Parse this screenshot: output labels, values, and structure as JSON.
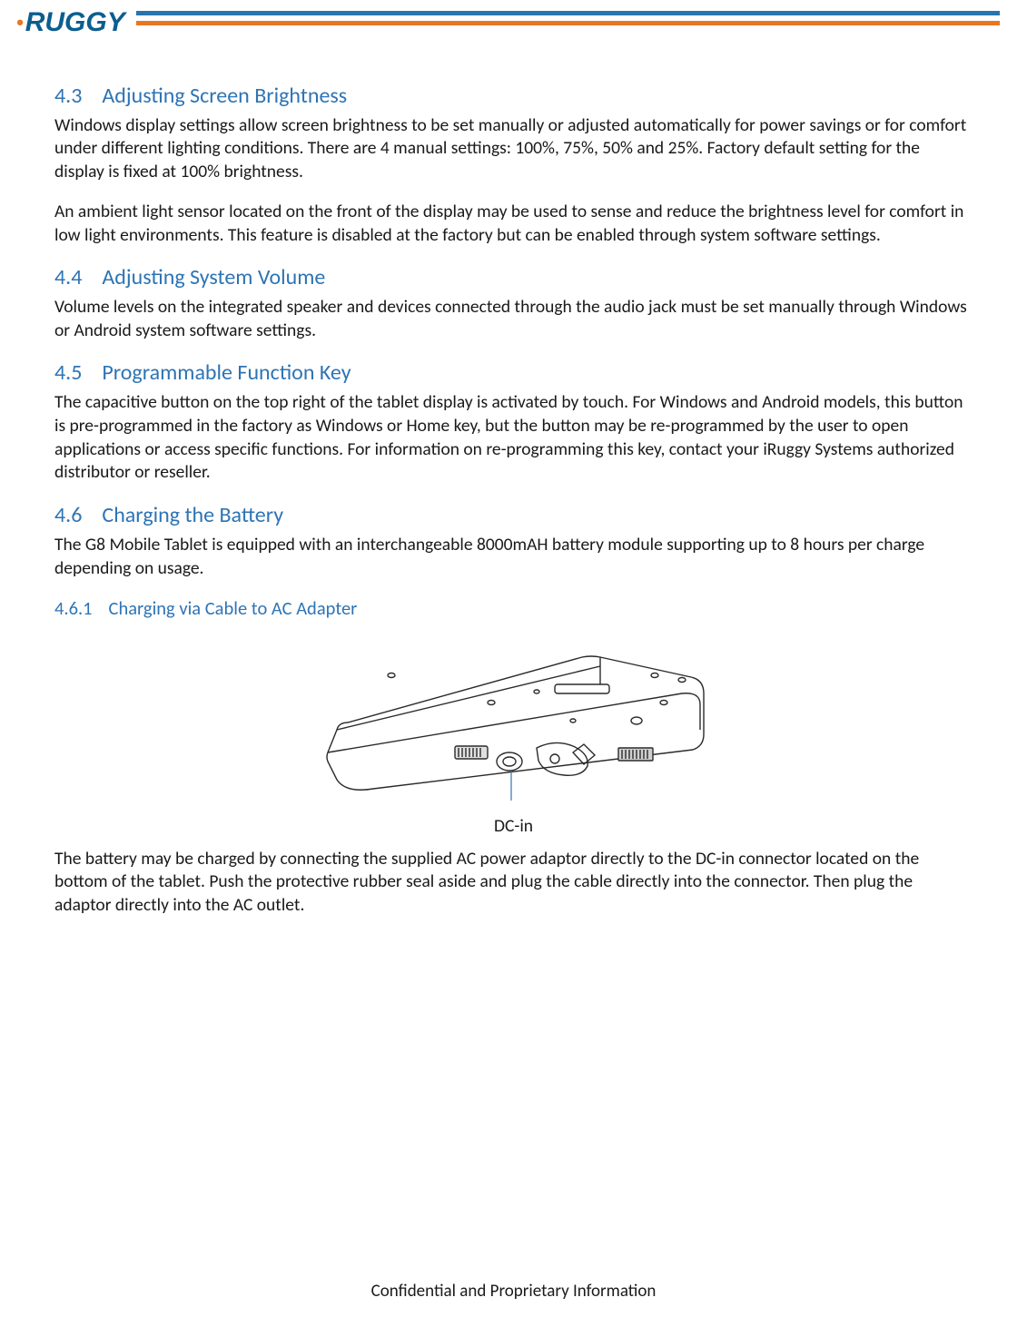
{
  "logo": {
    "dot_char": "•",
    "text": "RUGGY"
  },
  "sections": [
    {
      "num": "4.3",
      "title": "Adjusting Screen Brightness",
      "paras": [
        "Windows display settings allow screen brightness to be set manually or adjusted automatically for power savings or for comfort under different lighting conditions.  There are 4 manual settings: 100%, 75%, 50% and 25%.  Factory default setting for the display is fixed at 100% brightness.",
        "An ambient light sensor located on the front of the display may be used to sense and reduce the brightness level for comfort in low light environments.  This feature is disabled at the factory but can be enabled through system software settings."
      ]
    },
    {
      "num": "4.4",
      "title": "Adjusting System Volume",
      "paras": [
        "Volume levels on the integrated speaker and devices connected through the audio jack must be set manually through Windows or Android system software settings."
      ]
    },
    {
      "num": "4.5",
      "title": "Programmable Function Key",
      "paras": [
        "The capacitive button on the top right of the tablet display is activated by touch. For Windows and Android models, this button is pre-programmed in the factory as Windows or Home key, but the button may be re-programmed by the user to open applications or access specific functions.  For information on re-programming this key, contact your iRuggy Systems authorized distributor or reseller."
      ]
    },
    {
      "num": "4.6",
      "title": "Charging the Battery",
      "paras": [
        "The G8 Mobile Tablet is equipped with an interchangeable 8000mAH battery module supporting up to 8 hours per charge depending on usage."
      ],
      "subsections": [
        {
          "num": "4.6.1",
          "title": "Charging via Cable to AC Adapter",
          "figure_label": "DC-in",
          "paras_after": [
            "The battery may be charged by connecting the supplied AC power adaptor directly to the DC-in connector located on the bottom of the tablet.  Push the protective rubber seal aside and plug the cable directly into the connector.  Then plug the adaptor directly into the AC outlet."
          ]
        }
      ]
    }
  ],
  "footer": "Confidential and Proprietary Information"
}
